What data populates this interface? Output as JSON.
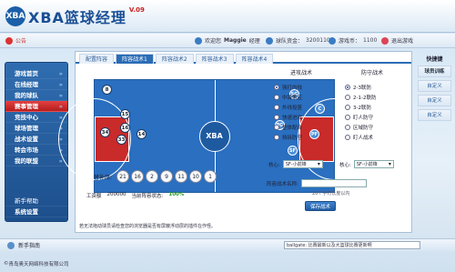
{
  "header": {
    "logo_mark": "XBA",
    "title": "XBA篮球经理",
    "version": "V.09"
  },
  "infobar": {
    "notice": "公告",
    "welcome": "欢迎您",
    "username": "Maggie",
    "role": "经理",
    "funds_label": "球队资金：",
    "funds_value": "3200110",
    "points_label": "游戏币：",
    "points_value": "1100",
    "logout": "退出游戏"
  },
  "sidebar": {
    "items": [
      "游戏首页",
      "在线经理",
      "我的球队",
      "赛事管理",
      "竞技中心",
      "球场管理",
      "战术设置",
      "转会市场",
      "我的联盟"
    ],
    "bottom": [
      "新手帮助",
      "系统设置"
    ]
  },
  "tabs": [
    "配置阵容",
    "阵容战术1",
    "阵容战术2",
    "阵容战术3",
    "阵容战术4"
  ],
  "court": {
    "center_text": "XBA",
    "left_players": [
      "8",
      "15",
      "34",
      "33",
      "14",
      "16"
    ],
    "positions": [
      "SG",
      "C",
      "PG",
      "PF",
      "SF"
    ]
  },
  "numbers_label": "替补席:",
  "bench_numbers": [
    "21",
    "16",
    "2",
    "9",
    "11",
    "10",
    "1"
  ],
  "salary": {
    "label": "工资额",
    "value": "200000",
    "status_label": "当前阵容状态:",
    "status_value": "100%"
  },
  "tactics": {
    "offense_title": "进攻战术",
    "defense_title": "防守战术",
    "offense": [
      "强打内线",
      "中锋策应",
      "外线投篮",
      "快速进攻",
      "整体配合",
      "挡拆防守"
    ],
    "defense": [
      "2-3联防",
      "2-1-2联防",
      "3-2联防",
      "盯人防守",
      "区域防守",
      "盯人战术"
    ],
    "core_label": "核心:",
    "core_offense": "SF-小前锋",
    "core_defense": "SF-小前锋"
  },
  "name_area": {
    "label": "阵容战术名称:",
    "hint": "20个字符长度以内",
    "save": "保存战术"
  },
  "tip": "若无法拖动球员请检查您的浏览器是否有屏蔽浮动层的插件在作怪。",
  "rightpanel": {
    "title": "快捷键",
    "items": [
      "球员训练",
      "自定义",
      "自定义",
      "自定义"
    ]
  },
  "footer": {
    "help": "新手指南",
    "message": "ballgate: 比赛最新以及大篮球比赛更新啊"
  },
  "copyright": "青岛奥天网络科技有限公司"
}
